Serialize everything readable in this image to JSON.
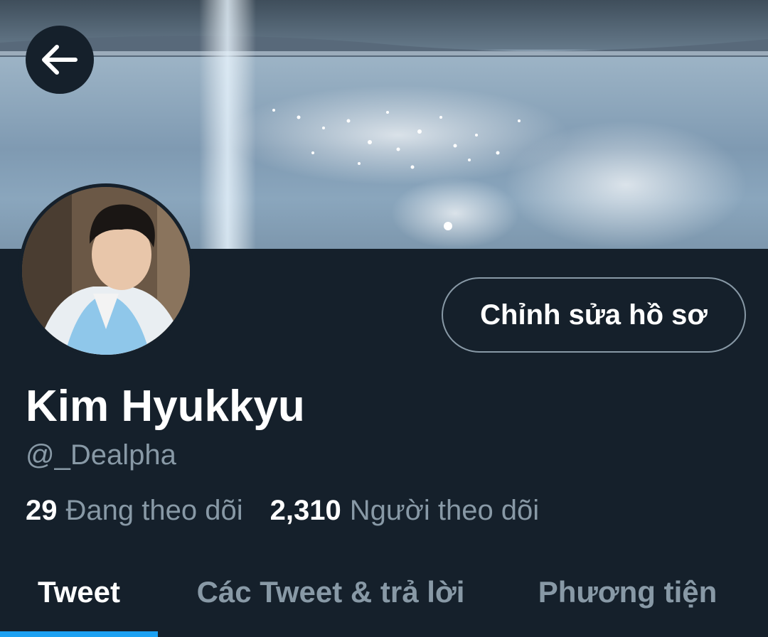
{
  "header": {
    "back_icon": "arrow-left-icon",
    "banner": "sea-water-sunlight-banner"
  },
  "profile": {
    "avatar": "profile-photo-man-in-blue-hanbok",
    "edit_button_label": "Chỉnh sửa hồ sơ",
    "name": "Kim Hyukkyu",
    "handle": "@_Dealpha",
    "following_count": "29",
    "following_label": "Đang theo dõi",
    "followers_count": "2,310",
    "followers_label": "Người theo dõi"
  },
  "tabs": [
    {
      "label": "Tweet",
      "active": true
    },
    {
      "label": "Các Tweet & trả lời",
      "active": false
    },
    {
      "label": "Phương tiện",
      "active": false
    }
  ],
  "colors": {
    "background": "#15202b",
    "accent": "#1da1f2",
    "secondary_text": "#8899a6"
  }
}
